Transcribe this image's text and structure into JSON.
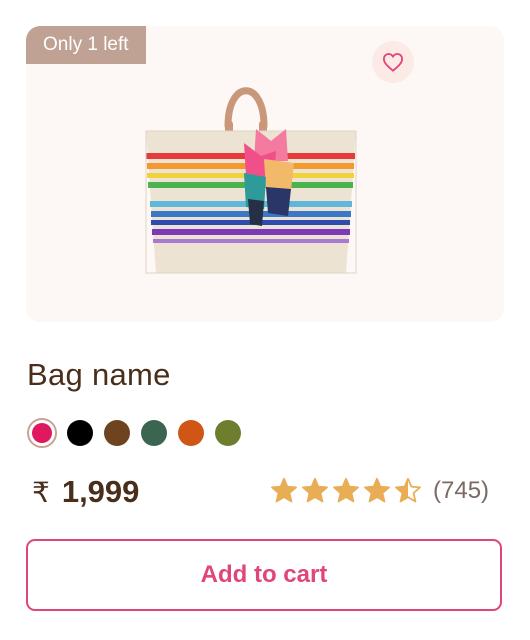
{
  "product": {
    "badge": "Only 1 left",
    "name": "Bag name",
    "currency_symbol": "₹",
    "price": "1,999",
    "rating": 4.5,
    "review_count": "(745)",
    "add_to_cart_label": "Add to cart",
    "selected_color_index": 0,
    "colors": [
      "#e0185e",
      "#000000",
      "#6e4320",
      "#3b6551",
      "#cf5614",
      "#6d7e2e"
    ]
  },
  "icons": {
    "wishlist": "heart-outline-icon",
    "rating": "star-icon"
  },
  "theme": {
    "accent": "#e0457b",
    "text_brown": "#4a2e1c",
    "star": "#e8ad55",
    "image_bg": "#fdf8f5",
    "badge_bg": "#bfa293"
  }
}
